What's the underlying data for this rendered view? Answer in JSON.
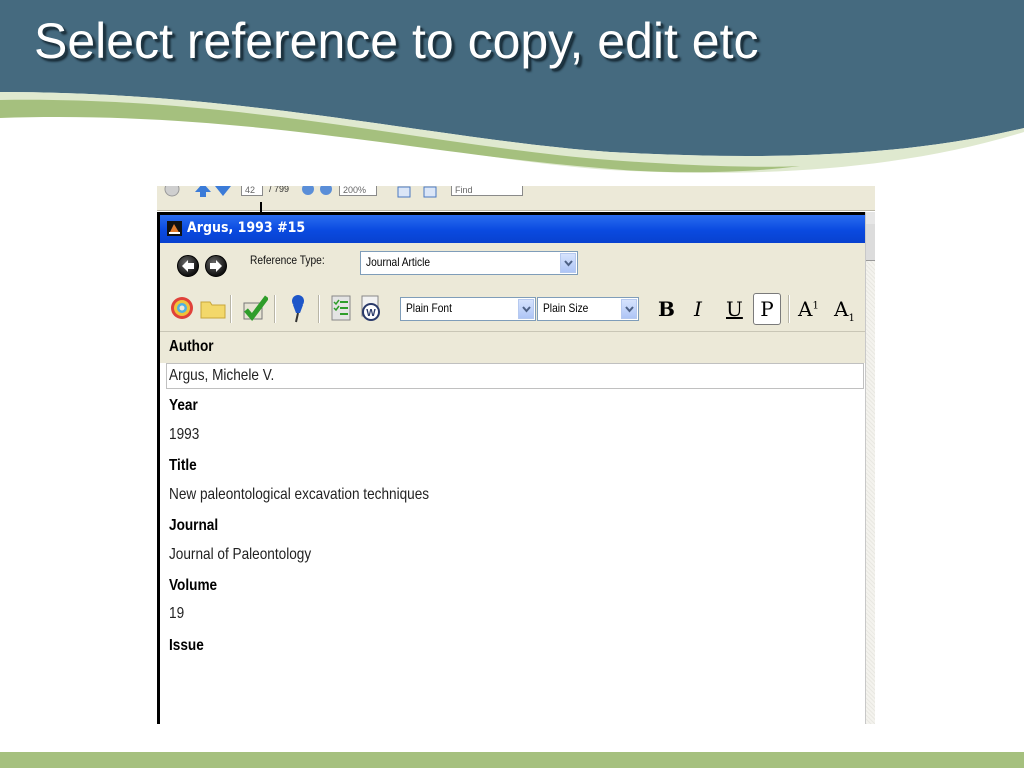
{
  "slide": {
    "title": "Select reference to copy, edit etc",
    "colors": {
      "header": "#456a7f",
      "swoosh_light": "#dfe9cf",
      "swoosh_green": "#a5c07e",
      "bottom_bar": "#a5c07e"
    }
  },
  "pdf_toolbar": {
    "page_current": "42",
    "page_total": "/ 799",
    "zoom": "200%",
    "find_placeholder": "Find"
  },
  "window": {
    "title": "Argus, 1993 #15",
    "title_color": "#0a4ae0",
    "reference_type_label": "Reference Type:",
    "reference_type_value": "Journal Article",
    "font_select": "Plain Font",
    "size_select": "Plain Size",
    "format": {
      "bold": "B",
      "italic": "I",
      "underline": "U",
      "plain": "P",
      "superscript_base": "A",
      "superscript_mark": "1",
      "subscript_base": "A",
      "subscript_mark": "1"
    }
  },
  "fields": [
    {
      "label": "Author",
      "value": "Argus, Michele V."
    },
    {
      "label": "Year",
      "value": "1993"
    },
    {
      "label": "Title",
      "value": "New paleontological excavation techniques"
    },
    {
      "label": "Journal",
      "value": "Journal of Paleontology"
    },
    {
      "label": "Volume",
      "value": "19"
    },
    {
      "label": "Issue",
      "value": ""
    }
  ],
  "icons": [
    "back-arrow-icon",
    "forward-arrow-icon",
    "rainbow-icon",
    "folder-icon",
    "checkmark-icon",
    "pushpin-icon",
    "checklist-icon",
    "word-icon",
    "app-icon"
  ]
}
